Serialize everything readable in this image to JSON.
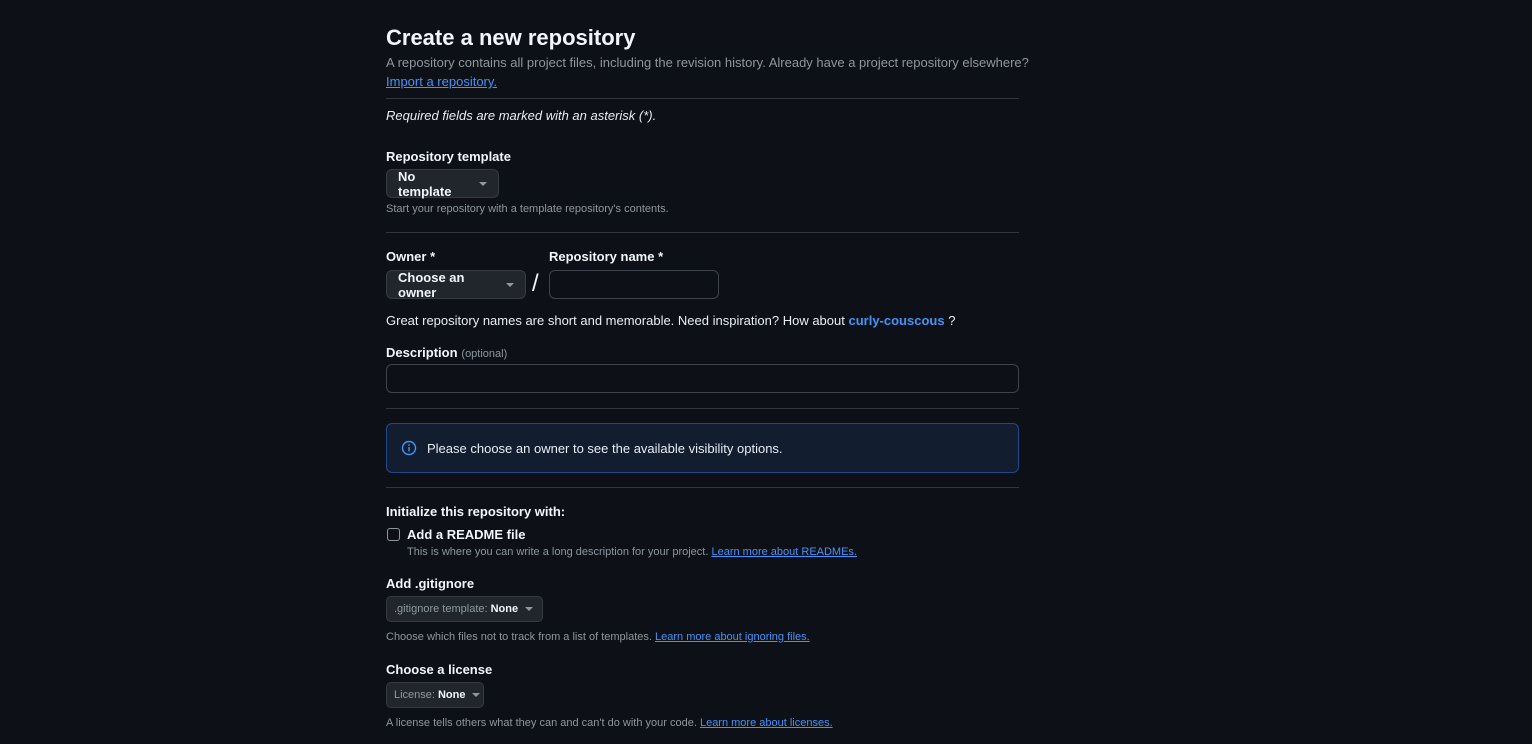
{
  "header": {
    "title": "Create a new repository",
    "subtitle": "A repository contains all project files, including the revision history. Already have a project repository elsewhere?",
    "import_link": "Import a repository."
  },
  "required_note": "Required fields are marked with an asterisk (*).",
  "template": {
    "label": "Repository template",
    "button": "No template",
    "hint": "Start your repository with a template repository's contents."
  },
  "owner": {
    "label": "Owner *",
    "button": "Choose an owner",
    "separator": "/"
  },
  "repo_name": {
    "label": "Repository name *",
    "value": ""
  },
  "suggestion": {
    "text": "Great repository names are short and memorable. Need inspiration? How about",
    "name": "curly-couscous",
    "suffix": "?"
  },
  "description": {
    "label": "Description",
    "optional": "(optional)",
    "value": ""
  },
  "visibility_banner": {
    "text": "Please choose an owner to see the available visibility options.",
    "icon": "info-icon",
    "accent": "#4493f8"
  },
  "initialize": {
    "heading": "Initialize this repository with:",
    "readme_label": "Add a README file",
    "readme_checked": false,
    "readme_hint": "This is where you can write a long description for your project.",
    "readme_link": "Learn more about READMEs."
  },
  "gitignore": {
    "heading": "Add .gitignore",
    "key": ".gitignore template:",
    "value": "None",
    "hint": "Choose which files not to track from a list of templates.",
    "link": "Learn more about ignoring files."
  },
  "license": {
    "heading": "Choose a license",
    "key": "License:",
    "value": "None",
    "hint": "A license tells others what they can and can't do with your code.",
    "link": "Learn more about licenses."
  }
}
